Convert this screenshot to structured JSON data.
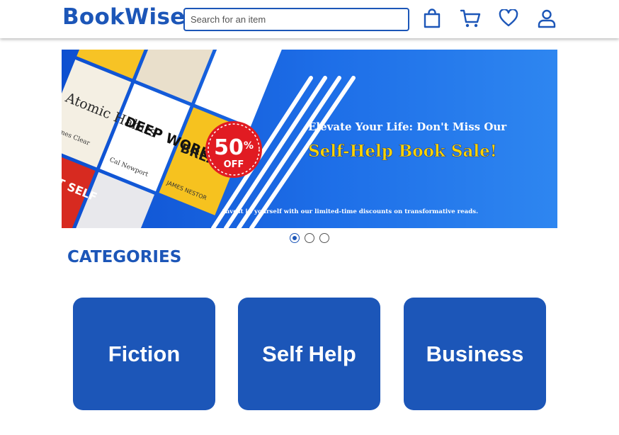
{
  "header": {
    "logo": "BookWise",
    "search_placeholder": "Search for an item"
  },
  "nav_icons": [
    "shopping-bag-icon",
    "cart-icon",
    "heart-icon",
    "user-icon"
  ],
  "banner": {
    "badge_percent": "50",
    "badge_symbol": "%",
    "badge_off": "OFF",
    "headline": "Elevate Your Life: Don't Miss Our",
    "sale_title": "Self-Help Book Sale!",
    "tagline": "Invest in yourself with our limited-time discounts on transformative reads.",
    "book_titles": [
      "Atomic Habits",
      "DEEP WORK",
      "BREATH",
      "BEST SELF"
    ],
    "book_authors": [
      "James Clear",
      "Cal Newport",
      "JAMES NESTOR"
    ],
    "slides_total": 3,
    "active_slide": 1
  },
  "categories": {
    "heading": "CATEGORIES",
    "items": [
      "Fiction",
      "Self Help",
      "Business"
    ]
  },
  "colors": {
    "brand": "#1c56b8",
    "banner_bg": "#1d6fe0",
    "badge_red": "#e11b22",
    "sale_yellow": "#ffd400"
  }
}
